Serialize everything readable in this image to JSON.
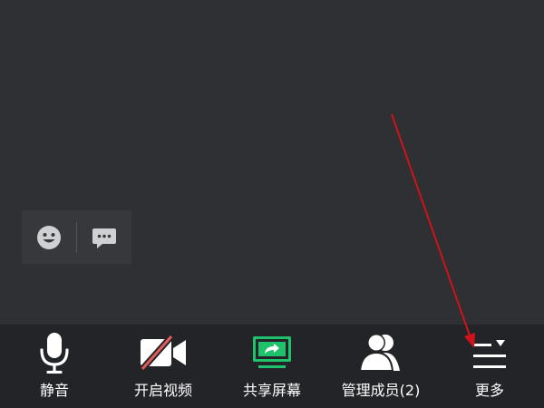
{
  "toolbar": {
    "items": [
      {
        "label": "静音",
        "icon": "microphone-icon"
      },
      {
        "label": "开启视频",
        "icon": "video-off-icon"
      },
      {
        "label": "共享屏幕",
        "icon": "share-screen-icon"
      },
      {
        "label": "管理成员(2)",
        "icon": "members-icon"
      },
      {
        "label": "更多",
        "icon": "more-menu-icon"
      }
    ]
  },
  "float_panel": {
    "items": [
      {
        "icon": "emoji-icon"
      },
      {
        "icon": "chat-icon"
      }
    ]
  },
  "colors": {
    "background": "#2e3033",
    "toolbar": "#232427",
    "share_accent": "#1fc26b",
    "video_off_slash": "#e45b5b",
    "annotation_arrow": "#d0131b"
  }
}
